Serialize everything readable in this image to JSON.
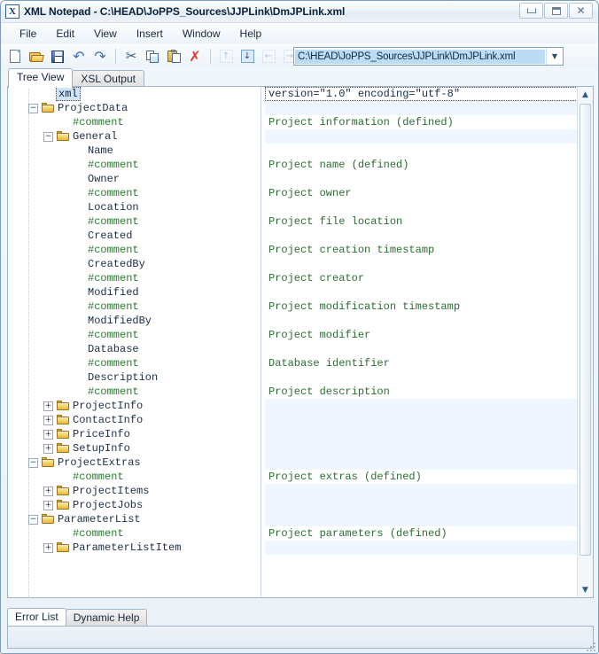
{
  "window": {
    "app_icon": "X",
    "title": "XML Notepad - C:\\HEAD\\JoPPS_Sources\\JJPLink\\DmJPLink.xml",
    "buttons": {
      "minimize": "minimize-button",
      "maximize": "maximize-button",
      "close": "close-button"
    }
  },
  "menu": {
    "items": [
      {
        "label": "File"
      },
      {
        "label": "Edit"
      },
      {
        "label": "View"
      },
      {
        "label": "Insert"
      },
      {
        "label": "Window"
      },
      {
        "label": "Help"
      }
    ]
  },
  "toolbar": {
    "buttons": [
      {
        "name": "new-icon",
        "enabled": true
      },
      {
        "name": "open-icon",
        "enabled": true
      },
      {
        "name": "save-icon",
        "enabled": true
      },
      {
        "name": "undo-icon",
        "enabled": true
      },
      {
        "name": "redo-icon",
        "enabled": true
      },
      {
        "name": "cut-icon",
        "enabled": true
      },
      {
        "name": "copy-icon",
        "enabled": true
      },
      {
        "name": "paste-icon",
        "enabled": true
      },
      {
        "name": "delete-icon",
        "enabled": true
      },
      {
        "name": "move-up-icon",
        "enabled": false
      },
      {
        "name": "move-down-icon",
        "enabled": true
      },
      {
        "name": "promote-icon",
        "enabled": false
      },
      {
        "name": "demote-icon",
        "enabled": false
      }
    ]
  },
  "address": {
    "value": "C:\\HEAD\\JoPPS_Sources\\JJPLink\\DmJPLink.xml",
    "placeholder": "File path",
    "dropdown_glyph": "▼"
  },
  "view_tabs": [
    {
      "label": "Tree View",
      "selected": true
    },
    {
      "label": "XSL Output",
      "selected": false
    }
  ],
  "tree": {
    "rows": [
      {
        "label": "xml",
        "icon": "pi-node",
        "depth": 0,
        "expander": "none",
        "selected": true,
        "value": "version=\"1.0\" encoding=\"utf-8\"",
        "value_style": "focus"
      },
      {
        "label": "ProjectData",
        "icon": "folder",
        "depth": 0,
        "expander": "minus",
        "selected": false,
        "value": "",
        "value_style": "alt"
      },
      {
        "label": "#comment",
        "icon": "comment-node",
        "depth": 1,
        "expander": "none",
        "selected": false,
        "value": "Project information (defined)",
        "value_style": "plain"
      },
      {
        "label": "General",
        "icon": "folder",
        "depth": 1,
        "expander": "minus",
        "selected": false,
        "value": "",
        "value_style": "alt"
      },
      {
        "label": "Name",
        "icon": "element-node",
        "depth": 2,
        "expander": "none",
        "selected": false,
        "value": "",
        "value_style": "plain"
      },
      {
        "label": "#comment",
        "icon": "comment-node",
        "depth": 2,
        "expander": "none",
        "selected": false,
        "value": "Project name (defined)",
        "value_style": "plain"
      },
      {
        "label": "Owner",
        "icon": "element-node",
        "depth": 2,
        "expander": "none",
        "selected": false,
        "value": "",
        "value_style": "plain"
      },
      {
        "label": "#comment",
        "icon": "comment-node",
        "depth": 2,
        "expander": "none",
        "selected": false,
        "value": "Project owner",
        "value_style": "plain"
      },
      {
        "label": "Location",
        "icon": "element-node",
        "depth": 2,
        "expander": "none",
        "selected": false,
        "value": "",
        "value_style": "plain"
      },
      {
        "label": "#comment",
        "icon": "comment-node",
        "depth": 2,
        "expander": "none",
        "selected": false,
        "value": "Project file location",
        "value_style": "plain"
      },
      {
        "label": "Created",
        "icon": "element-node",
        "depth": 2,
        "expander": "none",
        "selected": false,
        "value": "",
        "value_style": "plain"
      },
      {
        "label": "#comment",
        "icon": "comment-node",
        "depth": 2,
        "expander": "none",
        "selected": false,
        "value": "Project creation timestamp",
        "value_style": "plain"
      },
      {
        "label": "CreatedBy",
        "icon": "element-node",
        "depth": 2,
        "expander": "none",
        "selected": false,
        "value": "",
        "value_style": "plain"
      },
      {
        "label": "#comment",
        "icon": "comment-node",
        "depth": 2,
        "expander": "none",
        "selected": false,
        "value": "Project creator",
        "value_style": "plain"
      },
      {
        "label": "Modified",
        "icon": "element-node",
        "depth": 2,
        "expander": "none",
        "selected": false,
        "value": "",
        "value_style": "plain"
      },
      {
        "label": "#comment",
        "icon": "comment-node",
        "depth": 2,
        "expander": "none",
        "selected": false,
        "value": "Project modification timestamp",
        "value_style": "plain"
      },
      {
        "label": "ModifiedBy",
        "icon": "element-node",
        "depth": 2,
        "expander": "none",
        "selected": false,
        "value": "",
        "value_style": "plain"
      },
      {
        "label": "#comment",
        "icon": "comment-node",
        "depth": 2,
        "expander": "none",
        "selected": false,
        "value": "Project modifier",
        "value_style": "plain"
      },
      {
        "label": "Database",
        "icon": "element-node",
        "depth": 2,
        "expander": "none",
        "selected": false,
        "value": "",
        "value_style": "plain"
      },
      {
        "label": "#comment",
        "icon": "comment-node",
        "depth": 2,
        "expander": "none",
        "selected": false,
        "value": "Database identifier",
        "value_style": "plain"
      },
      {
        "label": "Description",
        "icon": "element-node",
        "depth": 2,
        "expander": "none",
        "selected": false,
        "value": "",
        "value_style": "plain"
      },
      {
        "label": "#comment",
        "icon": "comment-node",
        "depth": 2,
        "expander": "none",
        "selected": false,
        "value": "Project description",
        "value_style": "plain"
      },
      {
        "label": "ProjectInfo",
        "icon": "folder",
        "depth": 1,
        "expander": "plus",
        "selected": false,
        "value": "",
        "value_style": "alt"
      },
      {
        "label": "ContactInfo",
        "icon": "folder",
        "depth": 1,
        "expander": "plus",
        "selected": false,
        "value": "",
        "value_style": "alt"
      },
      {
        "label": "PriceInfo",
        "icon": "folder",
        "depth": 1,
        "expander": "plus",
        "selected": false,
        "value": "",
        "value_style": "alt"
      },
      {
        "label": "SetupInfo",
        "icon": "folder",
        "depth": 1,
        "expander": "plus",
        "selected": false,
        "value": "",
        "value_style": "alt"
      },
      {
        "label": "ProjectExtras",
        "icon": "folder",
        "depth": 0,
        "expander": "minus",
        "selected": false,
        "value": "",
        "value_style": "alt"
      },
      {
        "label": "#comment",
        "icon": "comment-node",
        "depth": 1,
        "expander": "none",
        "selected": false,
        "value": "Project extras (defined)",
        "value_style": "plain"
      },
      {
        "label": "ProjectItems",
        "icon": "folder",
        "depth": 1,
        "expander": "plus",
        "selected": false,
        "value": "",
        "value_style": "alt"
      },
      {
        "label": "ProjectJobs",
        "icon": "folder",
        "depth": 1,
        "expander": "plus",
        "selected": false,
        "value": "",
        "value_style": "alt"
      },
      {
        "label": "ParameterList",
        "icon": "folder",
        "depth": 0,
        "expander": "minus",
        "selected": false,
        "value": "",
        "value_style": "alt"
      },
      {
        "label": "#comment",
        "icon": "comment-node",
        "depth": 1,
        "expander": "none",
        "selected": false,
        "value": "Project parameters (defined)",
        "value_style": "plain"
      },
      {
        "label": "ParameterListItem",
        "icon": "folder",
        "depth": 1,
        "expander": "plus",
        "selected": false,
        "value": "",
        "value_style": "alt"
      }
    ]
  },
  "scrollbar": {
    "up_glyph": "▲",
    "down_glyph": "▼"
  },
  "bottom_tabs": [
    {
      "label": "Error List",
      "selected": true
    },
    {
      "label": "Dynamic Help",
      "selected": false
    }
  ],
  "colors": {
    "element_node": "#3f6fd0",
    "comment_node": "#46cc27",
    "processing_instruction": "#9a3fb4",
    "folder": "#eab83d",
    "value_text": "#2d6b34",
    "selection": "#cfe4f6",
    "alt_row": "#eff6fd"
  }
}
